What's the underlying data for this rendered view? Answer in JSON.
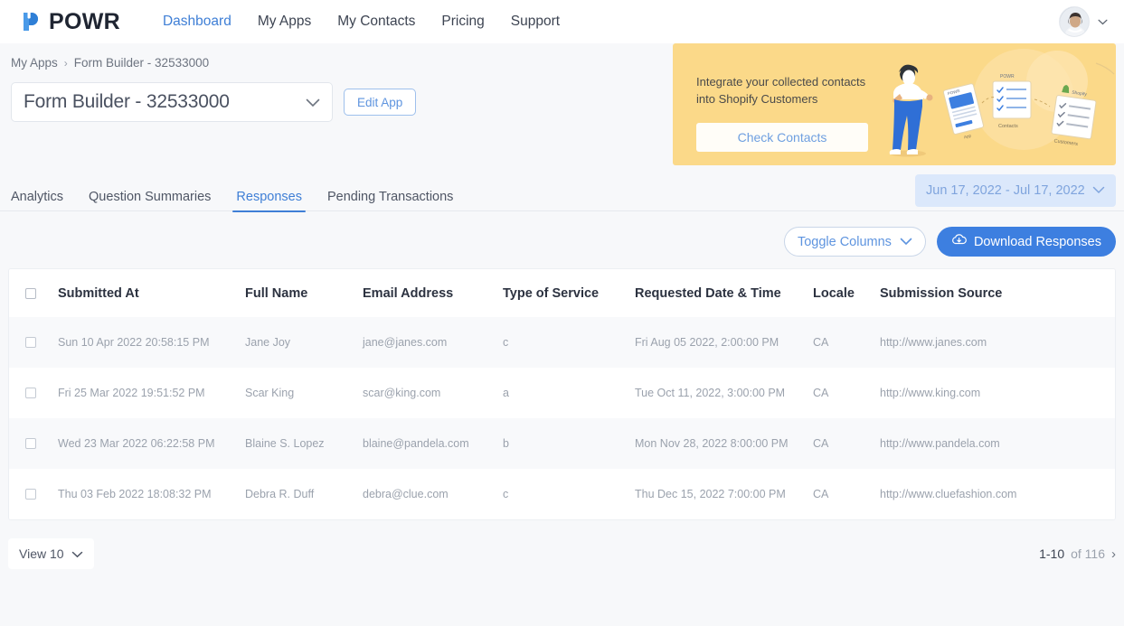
{
  "brand": {
    "name": "POWR",
    "logo_icon": "powr-logo-icon",
    "accent": "#3d7fe0"
  },
  "topnav": {
    "items": [
      {
        "label": "Dashboard",
        "active": true
      },
      {
        "label": "My Apps",
        "active": false
      },
      {
        "label": "My Contacts",
        "active": false
      },
      {
        "label": "Pricing",
        "active": false
      },
      {
        "label": "Support",
        "active": false
      }
    ],
    "avatar_icon": "avatar",
    "account_chevron_icon": "chevron-down-icon"
  },
  "breadcrumb": {
    "root": "My Apps",
    "separator": "›",
    "current": "Form Builder - 32533000"
  },
  "app_selector": {
    "value": "Form Builder - 32533000",
    "chevron_icon": "chevron-down-icon",
    "edit_label": "Edit App"
  },
  "promo": {
    "line1": "Integrate your collected contacts",
    "line2": "into Shopify Customers",
    "button_label": "Check Contacts",
    "bg_color": "#fbd989",
    "art_labels": {
      "app": "POWR",
      "card1": "App",
      "card2": "Contacts",
      "card3": "Customers",
      "shopify": "Shopify"
    }
  },
  "tabs": [
    {
      "label": "Analytics",
      "active": false
    },
    {
      "label": "Question Summaries",
      "active": false
    },
    {
      "label": "Responses",
      "active": true
    },
    {
      "label": "Pending Transactions",
      "active": false
    }
  ],
  "date_range": {
    "value": "Jun 17, 2022 - Jul 17, 2022",
    "chevron_icon": "chevron-down-icon"
  },
  "toolbar": {
    "toggle_columns_label": "Toggle Columns",
    "toggle_columns_icon": "chevron-down-icon",
    "download_label": "Download Responses",
    "download_icon": "cloud-download-icon"
  },
  "table": {
    "columns": [
      "Submitted At",
      "Full Name",
      "Email Address",
      "Type of Service",
      "Requested Date & Time",
      "Locale",
      "Submission Source"
    ],
    "rows": [
      {
        "submitted_at": "Sun 10 Apr 2022 20:58:15 PM",
        "full_name": "Jane Joy",
        "email": "jane@janes.com",
        "type_of_service": "c",
        "requested": "Fri Aug 05 2022, 2:00:00 PM",
        "locale": "CA",
        "source": "http://www.janes.com"
      },
      {
        "submitted_at": "Fri 25 Mar 2022 19:51:52 PM",
        "full_name": "Scar King",
        "email": "scar@king.com",
        "type_of_service": "a",
        "requested": "Tue Oct 11, 2022, 3:00:00 PM",
        "locale": "CA",
        "source": "http://www.king.com"
      },
      {
        "submitted_at": "Wed 23 Mar 2022 06:22:58 PM",
        "full_name": "Blaine S. Lopez",
        "email": "blaine@pandela.com",
        "type_of_service": "b",
        "requested": "Mon Nov 28, 2022 8:00:00 PM",
        "locale": "CA",
        "source": "http://www.pandela.com"
      },
      {
        "submitted_at": "Thu 03 Feb 2022 18:08:32 PM",
        "full_name": "Debra R. Duff",
        "email": "debra@clue.com",
        "type_of_service": "c",
        "requested": "Thu Dec 15, 2022 7:00:00 PM",
        "locale": "CA",
        "source": "http://www.cluefashion.com"
      }
    ]
  },
  "footer": {
    "view_label": "View 10",
    "view_chevron_icon": "chevron-down-icon",
    "range": "1-10",
    "total": "of 116",
    "next_icon": "›"
  }
}
